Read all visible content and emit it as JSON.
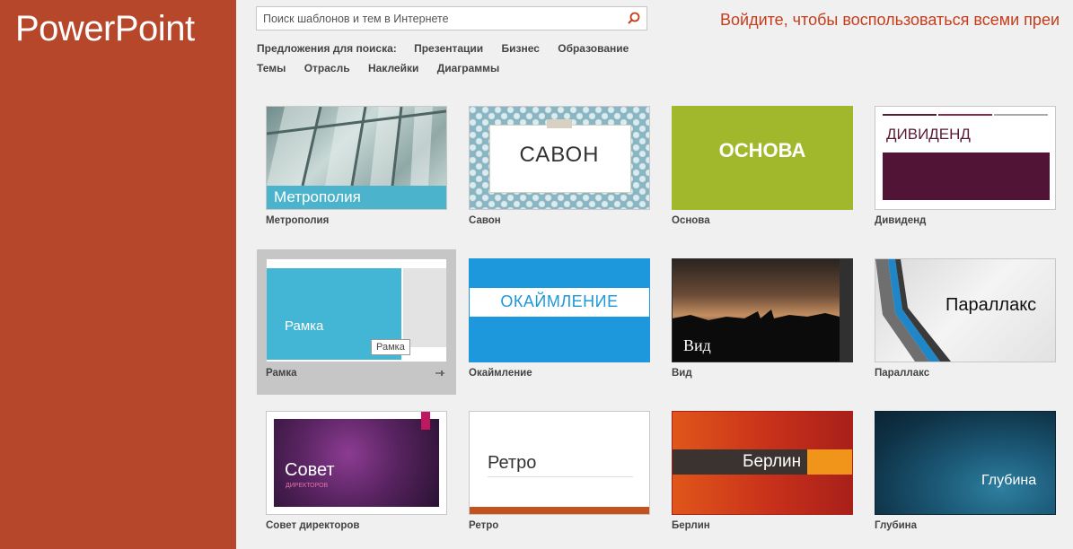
{
  "app": {
    "title": "PowerPoint"
  },
  "search": {
    "placeholder": "Поиск шаблонов и тем в Интернете",
    "icon": "search-icon"
  },
  "signin": {
    "text": "Войдите, чтобы воспользоваться всеми преи"
  },
  "suggestions": {
    "label": "Предложения для поиска:",
    "items": [
      "Презентации",
      "Бизнес",
      "Образование",
      "Темы",
      "Отрасль",
      "Наклейки",
      "Диаграммы"
    ]
  },
  "colors": {
    "sidebar": "#b7472a",
    "accent": "#c43e1c",
    "background": "#f0f0f0"
  },
  "templates": [
    {
      "name": "Метрополия",
      "thumb_text": "Метрополия"
    },
    {
      "name": "Савон",
      "thumb_text": "САВОН"
    },
    {
      "name": "Основа",
      "thumb_text": "ОСНОВА"
    },
    {
      "name": "Дивиденд",
      "thumb_text": "ДИВИДЕНД"
    },
    {
      "name": "Рамка",
      "thumb_text": "Рамка",
      "tooltip": "Рамка",
      "selected": true
    },
    {
      "name": "Окаймление",
      "thumb_text": "ОКАЙМЛЕНИЕ"
    },
    {
      "name": "Вид",
      "thumb_text": "Вид"
    },
    {
      "name": "Параллакс",
      "thumb_text": "Параллакс"
    },
    {
      "name": "Совет директоров",
      "thumb_text": "Совет",
      "thumb_subtext": "директоров"
    },
    {
      "name": "Ретро",
      "thumb_text": "Ретро"
    },
    {
      "name": "Берлин",
      "thumb_text": "Берлин"
    },
    {
      "name": "Глубина",
      "thumb_text": "Глубина"
    }
  ]
}
